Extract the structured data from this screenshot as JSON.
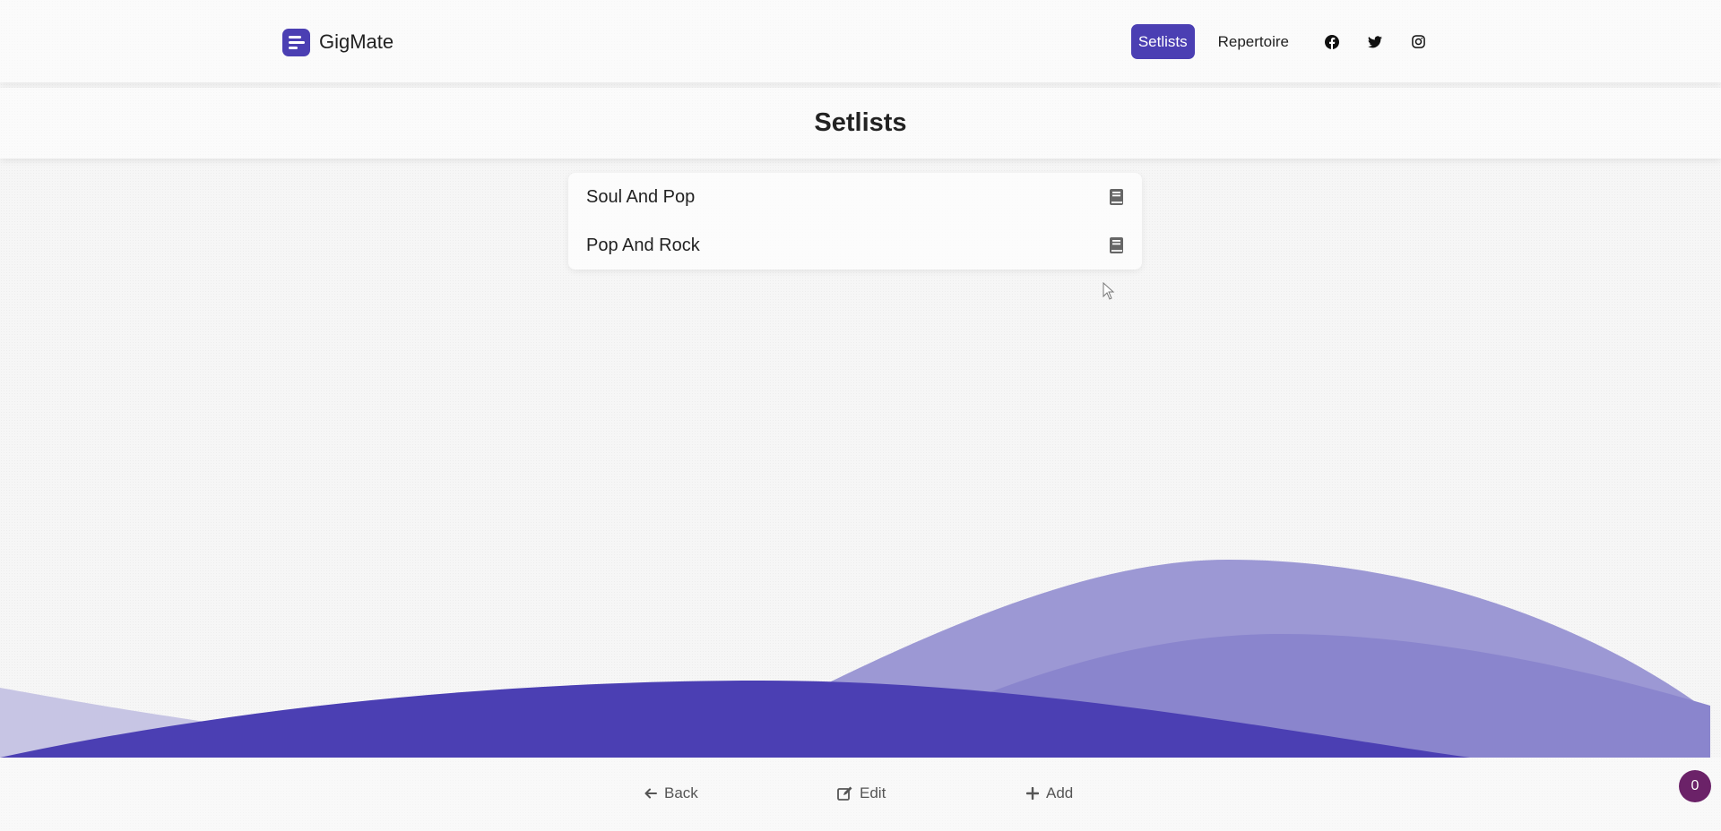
{
  "brand": {
    "name": "GigMate"
  },
  "nav": {
    "items": [
      {
        "label": "Setlists",
        "active": true
      },
      {
        "label": "Repertoire",
        "active": false
      }
    ],
    "social_icons": [
      "facebook-icon",
      "twitter-icon",
      "instagram-icon"
    ]
  },
  "page": {
    "title": "Setlists"
  },
  "setlists": [
    {
      "label": "Soul And Pop",
      "icon": "book-icon"
    },
    {
      "label": "Pop And Rock",
      "icon": "book-icon"
    }
  ],
  "actions": {
    "back_label": "Back",
    "edit_label": "Edit",
    "add_label": "Add"
  },
  "badge": {
    "count": "0"
  },
  "colors": {
    "accent": "#4b3fb3",
    "badge": "#6b2268",
    "wave_light": "#9c98d4",
    "wave_mid": "#8a85cd",
    "wave_dark": "#4b3fb3"
  }
}
